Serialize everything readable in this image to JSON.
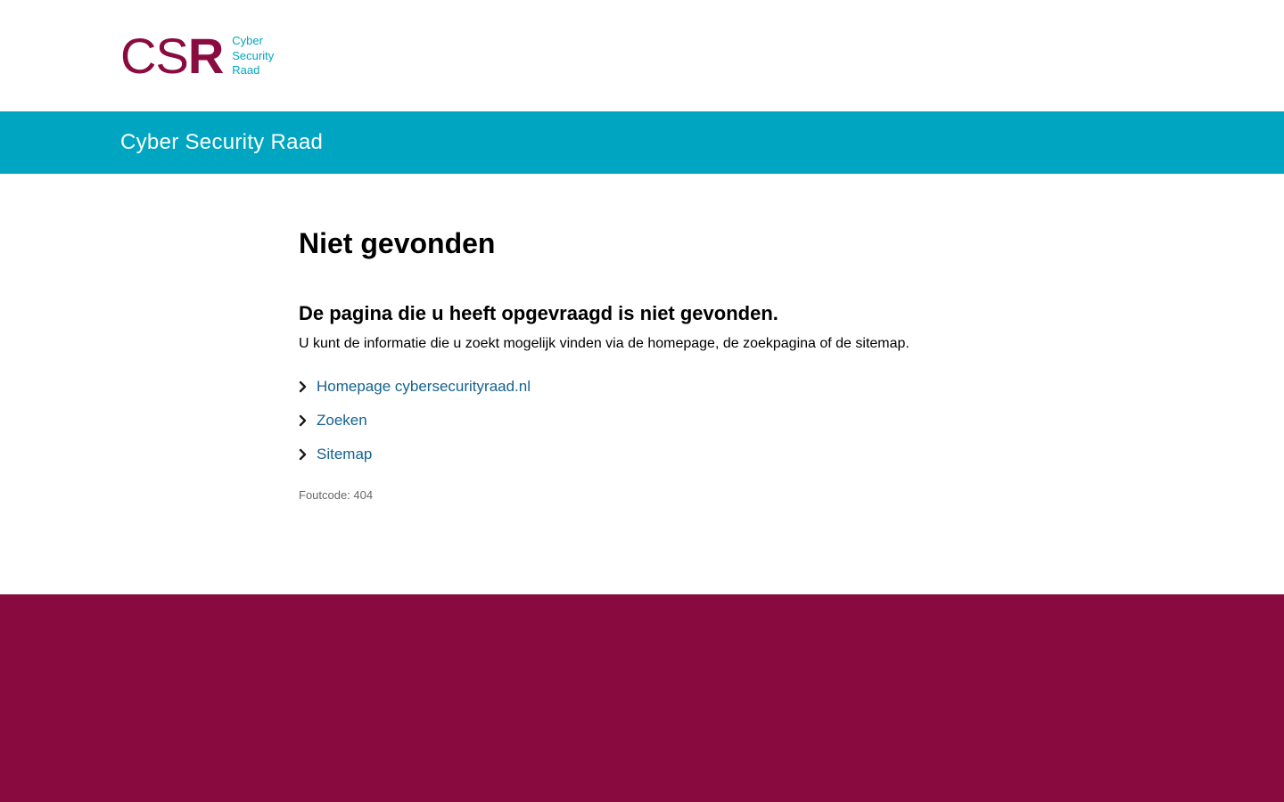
{
  "logo": {
    "mark_c": "C",
    "mark_s": "S",
    "mark_r": "R",
    "line1": "Cyber",
    "line2": "Security",
    "line3": "Raad"
  },
  "banner": {
    "title": "Cyber Security Raad"
  },
  "main": {
    "title": "Niet gevonden",
    "subtitle": "De pagina die u heeft opgevraagd is niet gevonden.",
    "intro": "U kunt de informatie die u zoekt mogelijk vinden via de homepage, de zoekpagina of de sitemap.",
    "links": [
      {
        "label": "Homepage cybersecurityraad.nl",
        "icon": "chevron-right-icon"
      },
      {
        "label": "Zoeken",
        "icon": "chevron-right-icon"
      },
      {
        "label": "Sitemap",
        "icon": "chevron-right-icon"
      }
    ],
    "error_code": "Foutcode: 404"
  },
  "colors": {
    "brand_maroon": "#890a3f",
    "brand_cyan": "#00a6c1",
    "link_blue": "#15628f"
  }
}
